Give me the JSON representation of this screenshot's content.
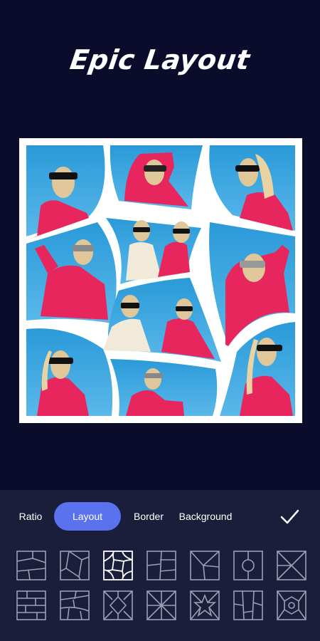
{
  "header": {
    "title": "Epic Layout"
  },
  "toolbar": {
    "tabs": [
      {
        "label": "Ratio",
        "active": false
      },
      {
        "label": "Layout",
        "active": true
      },
      {
        "label": "Border",
        "active": false
      },
      {
        "label": "Background",
        "active": false
      }
    ],
    "confirm_icon": "check-icon"
  },
  "colors": {
    "background": "#0b0b2b",
    "panel": "#1b1e3a",
    "accent": "#5b72ee",
    "thumb_stroke": "#9aa0b4",
    "thumb_selected_stroke": "#ffffff"
  },
  "layouts": {
    "selected_index": 2,
    "icons": [
      "grid-layout-1-icon",
      "grid-layout-2-icon",
      "grid-layout-3-icon",
      "grid-layout-4-icon",
      "grid-layout-5-icon",
      "grid-layout-6-icon",
      "grid-layout-7-icon",
      "grid-layout-8-icon",
      "grid-layout-9-icon",
      "grid-layout-10-icon",
      "grid-layout-11-icon",
      "grid-layout-12-icon",
      "grid-layout-13-icon",
      "grid-layout-14-icon"
    ]
  }
}
